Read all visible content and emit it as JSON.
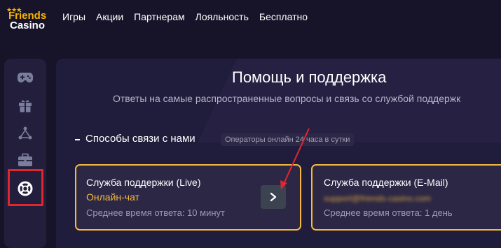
{
  "brand": {
    "line1": "Friends",
    "line2": "Casino",
    "stars": "★★★"
  },
  "nav": [
    {
      "label": "Игры"
    },
    {
      "label": "Акции"
    },
    {
      "label": "Партнерам"
    },
    {
      "label": "Лояльность"
    },
    {
      "label": "Бесплатно"
    }
  ],
  "sidebar": {
    "items": [
      {
        "icon": "gamepad-icon"
      },
      {
        "icon": "gift-icon"
      },
      {
        "icon": "network-icon"
      },
      {
        "icon": "briefcase-icon"
      },
      {
        "icon": "lifebuoy-icon",
        "highlighted": true
      }
    ]
  },
  "page": {
    "title": "Помощь и поддержка",
    "subtitle": "Ответы на самые распространенные вопросы и связь со службой поддержк"
  },
  "section": {
    "title": "Способы связи с нами",
    "badge": "Операторы онлайн 24 часа в сутки"
  },
  "cards": [
    {
      "title": "Служба поддержки (Live)",
      "accent": "Онлайн-чат",
      "meta": "Среднее время ответа: 10 минут"
    },
    {
      "title": "Служба поддержки (E-Mail)",
      "accent": "support@friends-casino.com",
      "meta": "Среднее время ответа: 1 день"
    }
  ],
  "colors": {
    "background": "#17142a",
    "accent": "#f5b840",
    "highlight": "#e0262f"
  }
}
